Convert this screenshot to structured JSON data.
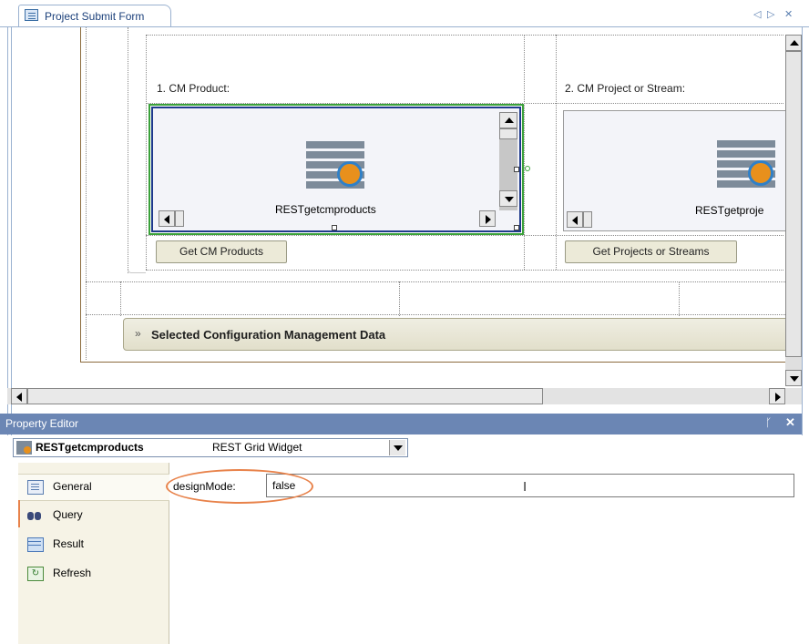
{
  "doc_tab": {
    "title": "Project Submit Form",
    "nav_prev": "◁",
    "nav_next": "▷",
    "close": "✕"
  },
  "form": {
    "field1_label": "1. CM Product:",
    "field2_label": "2. CM Project or Stream:",
    "widget1_name": "RESTgetcmproducts",
    "widget2_name": "RESTgetproje",
    "button1": "Get CM Products",
    "button2": "Get Projects or Streams",
    "section_title": "Selected Configuration Management Data",
    "section_chevron": "»"
  },
  "property_editor": {
    "title": "Property Editor",
    "pin": "ᚴ",
    "close": "✕",
    "selected_widget": "RESTgetcmproducts",
    "selected_type": "REST Grid Widget",
    "nav": [
      {
        "label": "General",
        "icon": "general-icon",
        "active": true
      },
      {
        "label": "Query",
        "icon": "binoculars-icon",
        "active": false
      },
      {
        "label": "Result",
        "icon": "table-icon",
        "active": false
      },
      {
        "label": "Refresh",
        "icon": "refresh-icon",
        "active": false
      }
    ],
    "field_label": "designMode:",
    "field_value": "false"
  },
  "colors": {
    "accent": "#6b86b4",
    "highlight": "#e8824a",
    "selection_green": "#3aa13a",
    "selection_blue": "#1f3a8c"
  }
}
